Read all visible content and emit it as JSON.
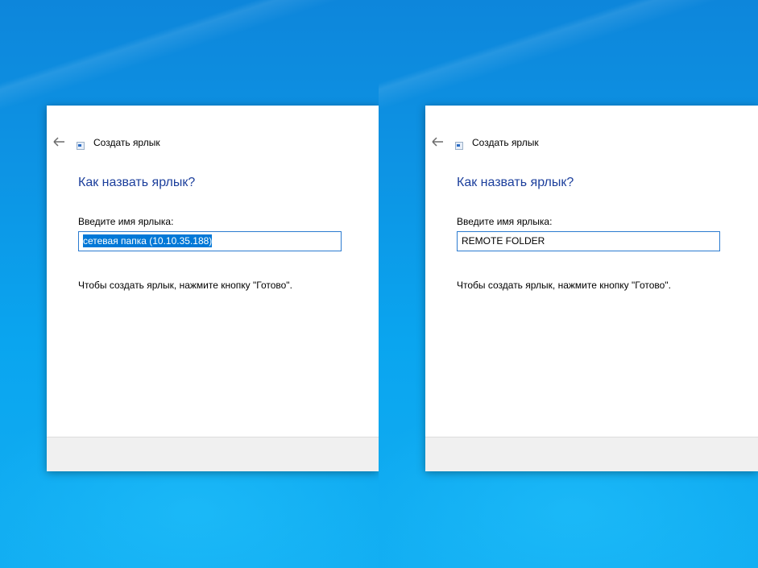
{
  "screens": [
    {
      "wizard_title": "Создать ярлык",
      "heading": "Как назвать ярлык?",
      "field_label": "Введите имя ярлыка:",
      "name_value": "сетевая папка (10.10.35.188)",
      "name_selected": true,
      "hint": "Чтобы создать ярлык, нажмите кнопку \"Готово\"."
    },
    {
      "wizard_title": "Создать ярлык",
      "heading": "Как назвать ярлык?",
      "field_label": "Введите имя ярлыка:",
      "name_value": "REMOTE FOLDER",
      "name_selected": false,
      "hint": "Чтобы создать ярлык, нажмите кнопку \"Готово\"."
    }
  ],
  "colors": {
    "heading": "#1c3f9c",
    "selection": "#0078d7",
    "input_border": "#2b7bd0",
    "desktop": "#0d94e4"
  },
  "icons": [
    "back-arrow-icon",
    "shortcut-icon"
  ]
}
